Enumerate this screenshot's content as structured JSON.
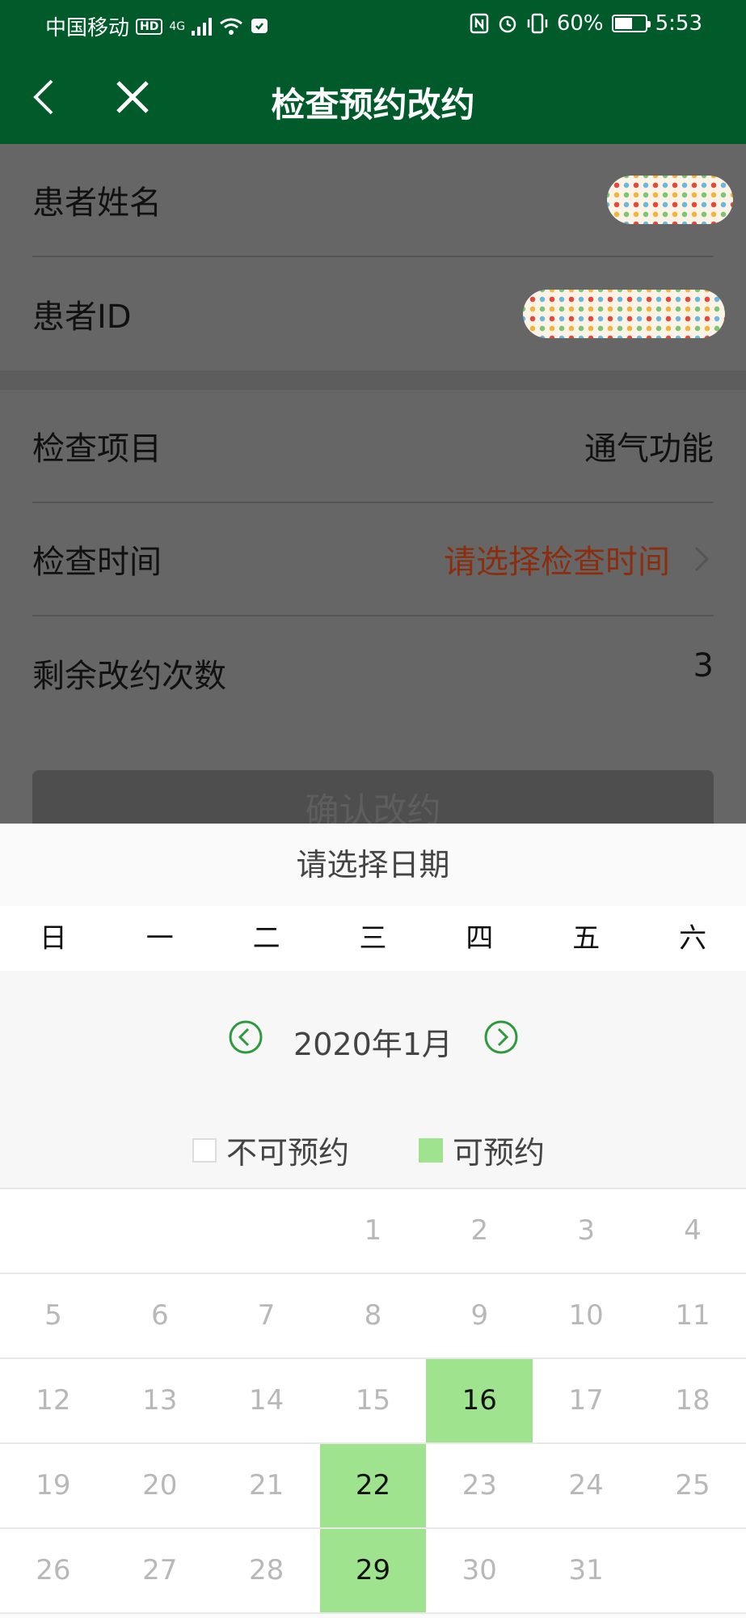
{
  "status_bar": {
    "carrier": "中国移动",
    "hd_badge": "HD",
    "network": "4G",
    "battery": "60%",
    "battery_level": 0.6,
    "time": "5:53"
  },
  "header": {
    "title": "检查预约改约",
    "back_icon": "chevron-left-icon",
    "close_icon": "close-icon"
  },
  "patient": {
    "name_label": "患者姓名",
    "id_label": "患者ID"
  },
  "exam": {
    "item_label": "检查项目",
    "item_value": "通气功能",
    "time_label": "检查时间",
    "time_hint": "请选择检查时间",
    "remaining_label": "剩余改约次数",
    "remaining_value": "3"
  },
  "confirm_button": "确认改约",
  "calendar": {
    "title": "请选择日期",
    "weekdays": [
      "日",
      "一",
      "二",
      "三",
      "四",
      "五",
      "六"
    ],
    "month": "2020年1月",
    "legend": {
      "unavailable": "不可预约",
      "available": "可预约"
    },
    "weeks": [
      [
        "",
        "",
        "",
        "1",
        "2",
        "3",
        "4"
      ],
      [
        "5",
        "6",
        "7",
        "8",
        "9",
        "10",
        "11"
      ],
      [
        "12",
        "13",
        "14",
        "15",
        "16",
        "17",
        "18"
      ],
      [
        "19",
        "20",
        "21",
        "22",
        "23",
        "24",
        "25"
      ],
      [
        "26",
        "27",
        "28",
        "29",
        "30",
        "31",
        ""
      ]
    ],
    "available_days": [
      "16",
      "22",
      "29"
    ],
    "colors": {
      "available": "#9fe38f",
      "accent": "#2e9a3e"
    }
  },
  "colors": {
    "header_bg": "#005a2a",
    "hint_text": "#8b2e10"
  }
}
